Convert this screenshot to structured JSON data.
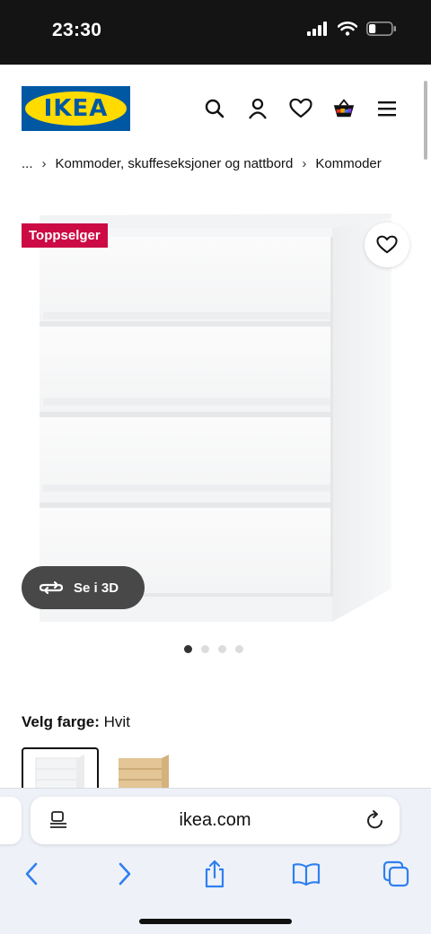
{
  "status_bar": {
    "time": "23:30",
    "battery_level": 0.3
  },
  "header": {
    "logo_text": "IKEA",
    "icons": [
      "search-icon",
      "account-icon",
      "heart-icon",
      "basket-icon",
      "menu-icon"
    ]
  },
  "breadcrumb": {
    "ellipsis": "...",
    "items": [
      "Kommoder, skuffeseksjoner og nattbord",
      "Kommoder"
    ]
  },
  "product": {
    "badge": "Toppselger",
    "view_3d_label": "Se i 3D",
    "image_count": 4,
    "active_image": 1
  },
  "color": {
    "label": "Velg farge:",
    "value": "Hvit",
    "swatches": [
      "white",
      "oak"
    ]
  },
  "browser": {
    "url": "ikea.com"
  },
  "colors": {
    "ikea_blue": "#0058a3",
    "ikea_yellow": "#ffdb00",
    "badge_red": "#cc0a44",
    "safari_blue": "#2f7ff0"
  }
}
